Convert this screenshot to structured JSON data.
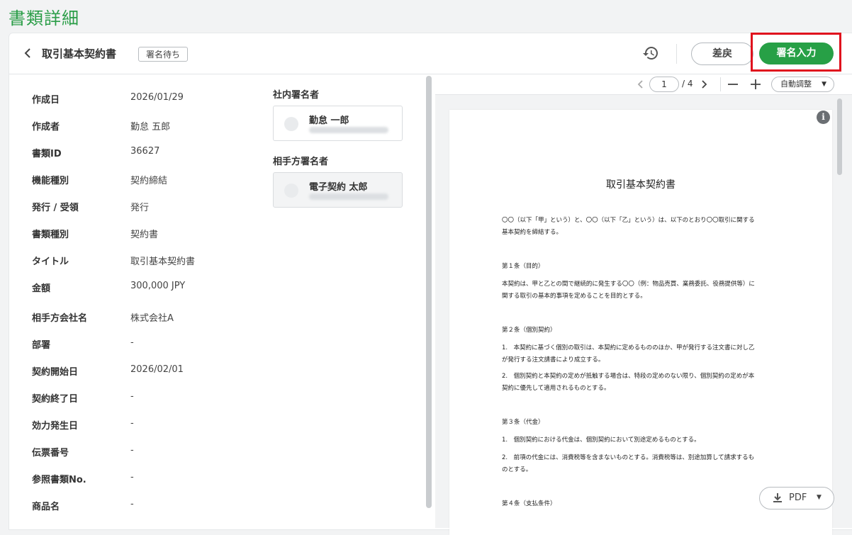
{
  "page": {
    "title": "書類詳細"
  },
  "header": {
    "doc_title": "取引基本契約書",
    "status": "署名待ち",
    "return_label": "差戻",
    "sign_label": "署名入力"
  },
  "fields": [
    {
      "label": "作成日",
      "value": "2026/01/29"
    },
    {
      "label": "作成者",
      "value": "勤怠 五郎"
    },
    {
      "label": "書類ID",
      "value": "36627"
    },
    {
      "label": "機能種別",
      "value": "契約締結"
    },
    {
      "label": "発行 / 受領",
      "value": "発行"
    },
    {
      "label": "書類種別",
      "value": "契約書"
    },
    {
      "label": "タイトル",
      "value": "取引基本契約書"
    },
    {
      "label": "金額",
      "value": "300,000 JPY"
    },
    {
      "label": "相手方会社名",
      "value": "株式会社A"
    },
    {
      "label": "部署",
      "value": "-"
    },
    {
      "label": "契約開始日",
      "value": "2026/02/01"
    },
    {
      "label": "契約終了日",
      "value": "-"
    },
    {
      "label": "効力発生日",
      "value": "-"
    },
    {
      "label": "伝票番号",
      "value": "-"
    },
    {
      "label": "参照書類No.",
      "value": "-"
    },
    {
      "label": "商品名",
      "value": "-"
    }
  ],
  "signers": {
    "internal_title": "社内署名者",
    "internal_name": "勤怠 一郎",
    "external_title": "相手方署名者",
    "external_name": "電子契約 太郎"
  },
  "pdf_toolbar": {
    "page_current": "1",
    "page_total": "/ 4",
    "zoom_label": "自動調整"
  },
  "pdf_doc": {
    "title": "取引基本契約書",
    "intro": "〇〇（以下「甲」という）と、〇〇（以下「乙」という）は、以下のとおり〇〇取引に関する\n基本契約を締結する。",
    "a1_heading": "第１条（目的）",
    "a1_text": "本契約は、甲と乙との間で継続的に発生する〇〇（例：物品売買、業務委託、役務提供等）に\n関する取引の基本的事項を定めることを目的とする。",
    "a2_heading": "第２条（個別契約）",
    "a2_p1": "1.　本契約に基づく個別の取引は、本契約に定めるもののほか、甲が発行する注文書に対し乙\nが発行する注文請書により成立する。",
    "a2_p2": "2.　個別契約と本契約の定めが抵触する場合は、特段の定めのない限り、個別契約の定めが本\n契約に優先して適用されるものとする。",
    "a3_heading": "第３条（代金）",
    "a3_p1": "1.　個別契約における代金は、個別契約において別途定めるものとする。",
    "a3_p2": "2.　前項の代金には、消費税等を含まないものとする。消費税等は、別途加算して請求するも\nのとする。",
    "a4_heading": "第４条（支払条件）"
  },
  "download": {
    "label": "PDF"
  }
}
